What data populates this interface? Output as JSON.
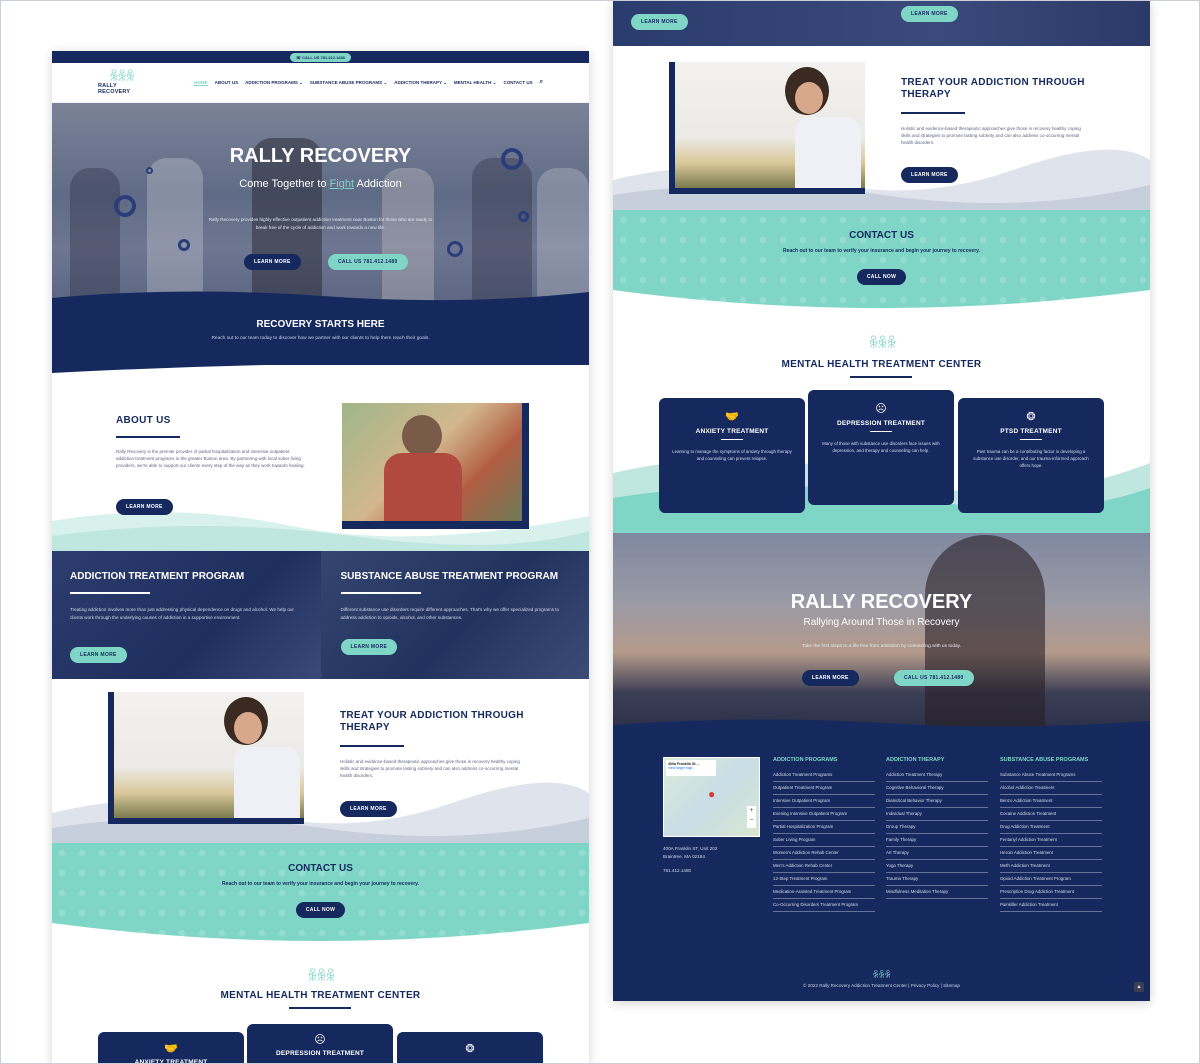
{
  "colors": {
    "navy": "#15295e",
    "mint": "#7fd6c7",
    "white": "#ffffff"
  },
  "top_bar": {
    "phone": "CALL US 781.412.1480"
  },
  "logo": {
    "text": "RALLY RECOVERY",
    "icon": "people-logo-icon"
  },
  "nav": {
    "items": [
      "HOME",
      "ABOUT US",
      "ADDICTION PROGRAMS",
      "SUBSTANCE ABUSE PROGRAMS",
      "ADDICTION THERAPY",
      "MENTAL HEALTH",
      "CONTACT US"
    ],
    "search_icon": "search-icon"
  },
  "hero": {
    "title": "RALLY RECOVERY",
    "subtitle_pre": "Come Together to ",
    "subtitle_mark": "Fight",
    "subtitle_post": " Addiction",
    "body": "Rally Recovery provides highly effective outpatient addiction treatment near Boston for those who are ready to break free of the cycle of addiction and work towards a new life.",
    "btn_learn": "LEARN MORE",
    "btn_call": "CALL US 781.412.1480"
  },
  "recovery": {
    "title": "RECOVERY STARTS HERE",
    "body": "Reach out to our team today to discover how we partner with our clients to help them reach their goals."
  },
  "about": {
    "title": "ABOUT US",
    "body": "Rally Recovery is the premier provider of partial hospitalization and intensive outpatient addiction treatment programs in the greater Boston area. By partnering with local sober living providers, we're able to support our clients every step of the way as they work towards healing.",
    "btn": "LEARN MORE"
  },
  "programs": [
    {
      "title": "ADDICTION TREATMENT PROGRAM",
      "body": "Treating addiction involves more than just addressing physical dependence on drugs and alcohol. We help our clients work through the underlying causes of addiction in a supportive environment.",
      "btn": "LEARN MORE"
    },
    {
      "title": "SUBSTANCE ABUSE TREATMENT PROGRAM",
      "body": "Different substance use disorders require different approaches. That's why we offer specialized programs to address addiction to opioids, alcohol, and other substances.",
      "btn": "LEARN MORE"
    }
  ],
  "therapy": {
    "title_line1": "TREAT YOUR ADDICTION THROUGH",
    "title_line2": "THERAPY",
    "body": "Holistic and evidence-based therapeutic approaches give those in recovery healthy coping skills and strategies to promote lasting sobriety and can also address co-occurring mental health disorders.",
    "btn": "LEARN MORE"
  },
  "contact": {
    "title": "CONTACT US",
    "body": "Reach out to our team to verify your insurance and begin your journey to recovery.",
    "btn": "CALL NOW"
  },
  "mental_health": {
    "title": "MENTAL HEALTH TREATMENT CENTER",
    "cards": [
      {
        "title": "ANXIETY TREATMENT",
        "icon": "handshake-icon",
        "body": "Learning to manage the symptoms of anxiety through therapy and counseling can prevent relapse."
      },
      {
        "title": "DEPRESSION TREATMENT",
        "icon": "sad-face-icon",
        "body": "Many of those with substance use disorders face issues with depression, and therapy and counseling can help."
      },
      {
        "title": "PTSD TREATMENT",
        "icon": "brain-icon",
        "body": "Past trauma can be a contributing factor in developing a substance use disorder, and our trauma-informed approach offers hope."
      }
    ]
  },
  "rallying": {
    "title": "RALLY RECOVERY",
    "subtitle": "Rallying Around Those in Recovery",
    "body": "Take the first steps to a life free from addiction by connecting with us today.",
    "btn_learn": "LEARN MORE",
    "btn_call": "CALL US 781.412.1480"
  },
  "footer": {
    "map": {
      "label": "400a Franklin St ...",
      "link": "View larger map",
      "zoom_in": "+",
      "zoom_out": "−"
    },
    "address_line1": "400A Franklin ST, Unit 202",
    "address_line2": "Braintree, MA 02184",
    "phone": "781.412.1480",
    "columns": [
      {
        "heading": "ADDICTION PROGRAMS",
        "items": [
          "Addiction Treatment Programs",
          "Outpatient Treatment Program",
          "Intensive Outpatient Program",
          "Evening Intensive Outpatient Program",
          "Partial Hospitalization Program",
          "Sober Living Program",
          "Women's Addiction Rehab Center",
          "Men's Addiction Rehab Center",
          "12-Step Treatment Program",
          "Medication-Assisted Treatment Program",
          "Co-Occurring Disorders Treatment Program"
        ]
      },
      {
        "heading": "ADDICTION THERAPY",
        "items": [
          "Addiction Treatment Therapy",
          "Cognitive Behavioral Therapy",
          "Dialectical Behavior Therapy",
          "Individual Therapy",
          "Group Therapy",
          "Family Therapy",
          "Art Therapy",
          "Yoga Therapy",
          "Trauma Therapy",
          "Mindfulness Meditation Therapy"
        ]
      },
      {
        "heading": "SUBSTANCE ABUSE PROGRAMS",
        "items": [
          "Substance Abuse Treatment Programs",
          "Alcohol Addiction Treatment",
          "Benzo Addiction Treatment",
          "Cocaine Addiction Treatment",
          "Drug Addiction Treatment",
          "Fentanyl Addiction Treatment",
          "Heroin Addiction Treatment",
          "Meth Addiction Treatment",
          "Opioid Addiction Treatment Program",
          "Prescription Drug Addiction Treatment",
          "Painkiller Addiction Treatment"
        ]
      }
    ],
    "copyright": "© 2022 Rally Recovery Addiction Treatment Center | Privacy Policy | Sitemap"
  }
}
